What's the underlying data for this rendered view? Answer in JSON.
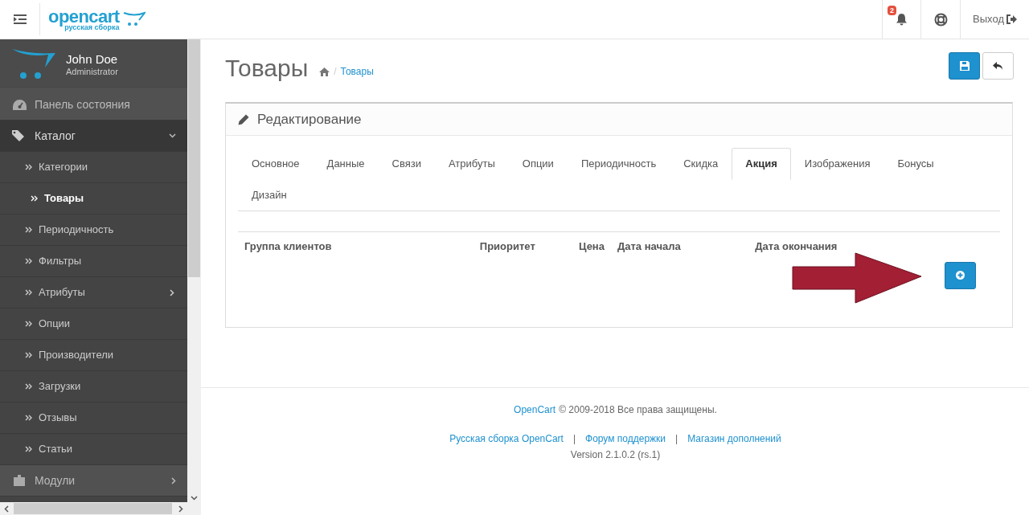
{
  "header": {
    "logo": {
      "name": "opencart",
      "tagline": "русская сборка"
    },
    "notification_count": "2",
    "logout": "Выход"
  },
  "sidebar": {
    "user": {
      "name": "John Doe",
      "role": "Administrator"
    },
    "menu": [
      {
        "label": "Панель состояния",
        "selected": false,
        "submenu": false
      },
      {
        "label": "Каталог",
        "selected": true,
        "submenu": true,
        "expanded": true,
        "children": [
          {
            "label": "Категории",
            "selected": false,
            "submenu": false
          },
          {
            "label": "Товары",
            "selected": true,
            "submenu": false
          },
          {
            "label": "Периодичность",
            "selected": false,
            "submenu": false
          },
          {
            "label": "Фильтры",
            "selected": false,
            "submenu": false
          },
          {
            "label": "Атрибуты",
            "selected": false,
            "submenu": true
          },
          {
            "label": "Опции",
            "selected": false,
            "submenu": false
          },
          {
            "label": "Производители",
            "selected": false,
            "submenu": false
          },
          {
            "label": "Загрузки",
            "selected": false,
            "submenu": false
          },
          {
            "label": "Отзывы",
            "selected": false,
            "submenu": false
          },
          {
            "label": "Статьи",
            "selected": false,
            "submenu": false
          }
        ]
      },
      {
        "label": "Модули",
        "selected": false,
        "submenu": true,
        "expanded": false
      }
    ]
  },
  "page": {
    "title": "Товары",
    "breadcrumb": [
      "Товары"
    ],
    "breadcrumb_separator": "/"
  },
  "panel": {
    "heading": "Редактирование",
    "tabs": [
      {
        "label": "Основное",
        "selected": false
      },
      {
        "label": "Данные",
        "selected": false
      },
      {
        "label": "Связи",
        "selected": false
      },
      {
        "label": "Атрибуты",
        "selected": false
      },
      {
        "label": "Опции",
        "selected": false
      },
      {
        "label": "Периодичность",
        "selected": false
      },
      {
        "label": "Скидка",
        "selected": false
      },
      {
        "label": "Акция",
        "selected": true
      },
      {
        "label": "Изображения",
        "selected": false
      },
      {
        "label": "Бонусы",
        "selected": false
      },
      {
        "label": "Дизайн",
        "selected": false
      }
    ],
    "table": {
      "columns": [
        "Группа клиентов",
        "Приоритет",
        "Цена",
        "Дата начала",
        "Дата окончания"
      ]
    }
  },
  "footer": {
    "copyright_link": "OpenCart",
    "copyright": "© 2009-2018 Все права защищены.",
    "links": [
      "Русская сборка OpenCart",
      "Форум поддержки",
      "Магазин дополнений"
    ],
    "separator": "|",
    "version": "Version 2.1.0.2 (rs.1)"
  }
}
